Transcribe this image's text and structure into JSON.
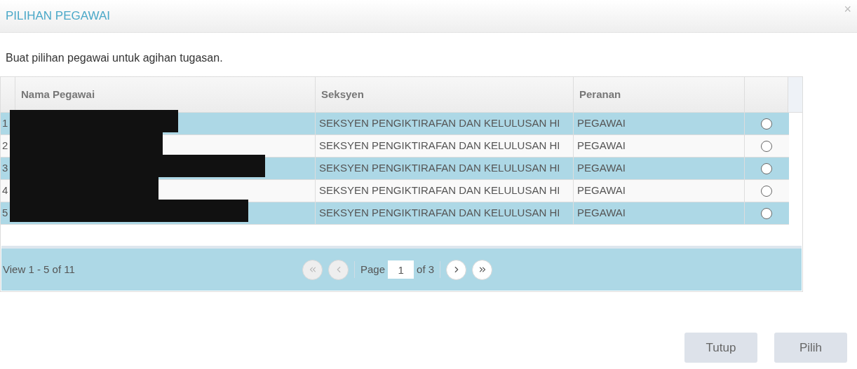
{
  "dialog": {
    "title": "PILIHAN PEGAWAI",
    "close": "×"
  },
  "instruction": "Buat pilihan pegawai untuk agihan tugasan.",
  "table": {
    "columns": [
      "Nama Pegawai",
      "Seksyen",
      "Peranan"
    ],
    "rows": [
      {
        "number": "1",
        "name_redacted": true,
        "section": "SEKSYEN PENGIKTIRAFAN DAN KELULUSAN HI",
        "role": "PEGAWAI",
        "selected": false
      },
      {
        "number": "2",
        "name_redacted": true,
        "section": "SEKSYEN PENGIKTIRAFAN DAN KELULUSAN HI",
        "role": "PEGAWAI",
        "selected": false
      },
      {
        "number": "3",
        "name_redacted": true,
        "section": "SEKSYEN PENGIKTIRAFAN DAN KELULUSAN HI",
        "role": "PEGAWAI",
        "selected": false
      },
      {
        "number": "4",
        "name_redacted": true,
        "section": "SEKSYEN PENGIKTIRAFAN DAN KELULUSAN HI",
        "role": "PEGAWAI",
        "selected": false
      },
      {
        "number": "5",
        "name_redacted": true,
        "section": "SEKSYEN PENGIKTIRAFAN DAN KELULUSAN HI",
        "role": "PEGAWAI",
        "selected": false
      }
    ]
  },
  "pager": {
    "summary": "View 1 - 5 of 11",
    "page_label": "Page",
    "page": "1",
    "of_label": "of 3",
    "first_disabled": true,
    "prev_disabled": true
  },
  "buttons": [
    "Tutup",
    "Pilih"
  ]
}
